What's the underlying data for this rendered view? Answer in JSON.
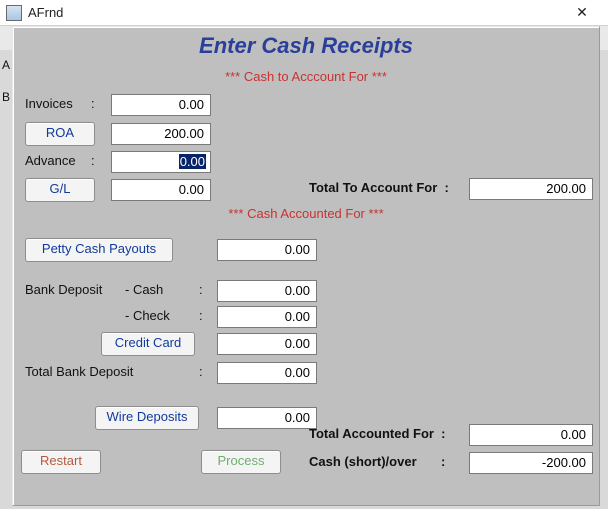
{
  "window": {
    "title": "AFrnd"
  },
  "heading": "Enter Cash Receipts",
  "section1_title": "*** Cash to Acccount For ***",
  "section2_title": "*** Cash Accounted For ***",
  "fields": {
    "invoices_label": "Invoices",
    "invoices_value": "0.00",
    "roa_button": "ROA",
    "roa_value": "200.00",
    "advance_label": "Advance",
    "advance_value": "0.00",
    "gl_button": "G/L",
    "gl_value": "0.00",
    "total_to_account_label": "Total To Account For",
    "total_to_account_value": "200.00"
  },
  "accounted": {
    "petty_cash_button": "Petty Cash Payouts",
    "petty_cash_value": "0.00",
    "bank_deposit_label": "Bank Deposit",
    "cash_label": "- Cash",
    "cash_value": "0.00",
    "check_label": "- Check",
    "check_value": "0.00",
    "credit_card_button": "Credit Card",
    "credit_card_value": "0.00",
    "total_bank_deposit_label": "Total Bank Deposit",
    "total_bank_deposit_value": "0.00",
    "wire_deposits_button": "Wire Deposits",
    "wire_deposits_value": "0.00",
    "total_accounted_label": "Total Accounted For",
    "total_accounted_value": "0.00",
    "cash_short_label": "Cash (short)/over",
    "cash_short_value": "-200.00"
  },
  "buttons": {
    "restart": "Restart",
    "process": "Process"
  }
}
